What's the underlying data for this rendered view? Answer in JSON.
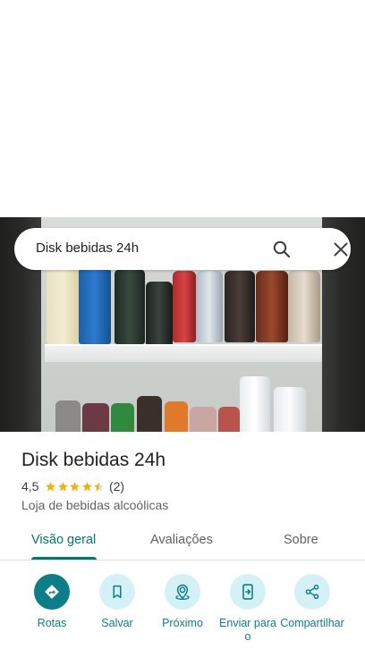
{
  "search": {
    "query": "Disk bebidas 24h"
  },
  "icons": {
    "search": "search-icon",
    "close": "close-icon",
    "directions": "directions-icon",
    "save": "bookmark-icon",
    "nearby": "nearby-icon",
    "send": "send-to-phone-icon",
    "share": "share-icon"
  },
  "place": {
    "name": "Disk bebidas 24h",
    "rating": "4,5",
    "rating_value": 4.5,
    "rating_max": 5,
    "review_count": "(2)",
    "category": "Loja de bebidas alcoólicas"
  },
  "tabs": [
    {
      "label": "Visão geral",
      "active": true
    },
    {
      "label": "Avaliações",
      "active": false
    },
    {
      "label": "Sobre",
      "active": false
    }
  ],
  "actions": [
    {
      "label": "Rotas"
    },
    {
      "label": "Salvar"
    },
    {
      "label": "Próximo"
    },
    {
      "label": "Enviar para o"
    },
    {
      "label": "Compartilhar"
    }
  ],
  "colors": {
    "accent": "#0b7f87",
    "tab_active": "#00796b",
    "action_bg": "#d4f2f5",
    "star": "#f4b400"
  }
}
